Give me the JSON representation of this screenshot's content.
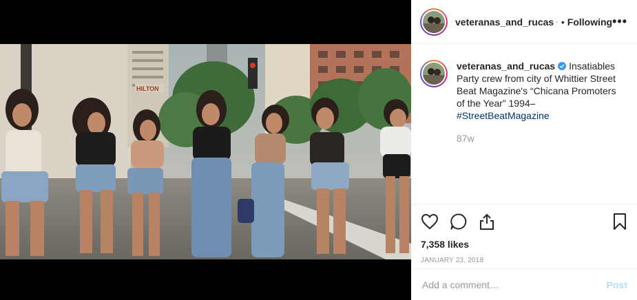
{
  "header": {
    "username": "veteranas_and_rucas",
    "separator": "•",
    "follow_state": "Following",
    "more": "•••"
  },
  "caption": {
    "username": "veteranas_and_rucas",
    "text": "Insatiables Party crew from city of Whittier Street Beat Magazine's “Chicana Promoters of the Year” 1994–",
    "hashtag": "#StreetBeatMagazine",
    "time": "87w"
  },
  "photo": {
    "sign_text": "HILTON"
  },
  "stats": {
    "likes": "7,358 likes",
    "date": "JANUARY 23, 2018"
  },
  "comment_box": {
    "placeholder": "Add a comment…",
    "post_label": "Post"
  },
  "colors": {
    "verified": "#3897f0",
    "link": "#003569",
    "post_disabled": "#b2dffc",
    "muted": "#999999"
  },
  "icons": [
    "verified-badge-icon",
    "heart-icon",
    "comment-icon",
    "share-icon",
    "bookmark-icon"
  ]
}
